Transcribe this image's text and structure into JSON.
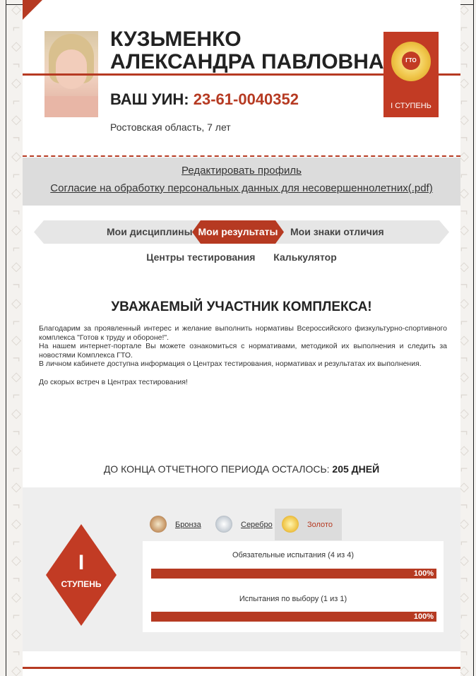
{
  "profile": {
    "name": "КУЗЬМЕНКО АЛЕКСАНДРА ПАВЛОВНА",
    "uin_label": "ВАШ УИН:",
    "uin_value": "23-61-0040352",
    "region_age": "Ростовская область, 7 лет"
  },
  "badge": {
    "emblem_text": "ГТО",
    "label": "I СТУПЕНЬ"
  },
  "links": {
    "edit_profile": "Редактировать профиль",
    "consent": "Согласие на обработку персональных данных для несовершеннолетних(.pdf)"
  },
  "tabs": {
    "disciplines": "Мои дисциплины",
    "results": "Мои результаты",
    "signs": "Мои знаки отличия",
    "centers": "Центры тестирования",
    "calculator": "Калькулятор"
  },
  "welcome": {
    "title": "УВАЖАЕМЫЙ УЧАСТНИК КОМПЛЕКСА!",
    "p1": "Благодарим за проявленный интерес и желание выполнить нормативы Всероссийского физкультурно-спортивного комплекса \"Готов к труду и обороне!\".",
    "p2": "На нашем интернет-портале Вы можете ознакомиться с нормативами, методикой их выполнения и следить за новостями Комплекса ГТО.",
    "p3": "В личном кабинете доступна информация о Центрах тестирования, нормативах и результатах их выполнения.",
    "p4": "До скорых встреч в Центрах тестирования!"
  },
  "period": {
    "label": "ДО КОНЦА ОТЧЕТНОГО ПЕРИОДА ОСТАЛОСЬ:",
    "value": "205 ДНЕЙ"
  },
  "level": {
    "number": "I",
    "label": "СТУПЕНЬ"
  },
  "medals": {
    "bronze": "Бронза",
    "silver": "Серебро",
    "gold": "Золото"
  },
  "results": {
    "required_label": "Обязательные испытания (4 из 4)",
    "required_pct": "100%",
    "required_fraction": 1.0,
    "optional_label": "Испытания по выбору (1 из 1)",
    "optional_pct": "100%",
    "optional_fraction": 1.0
  },
  "colors": {
    "accent": "#b63a22",
    "badge": "#c23b24",
    "grey_band": "#dcdcdc"
  }
}
